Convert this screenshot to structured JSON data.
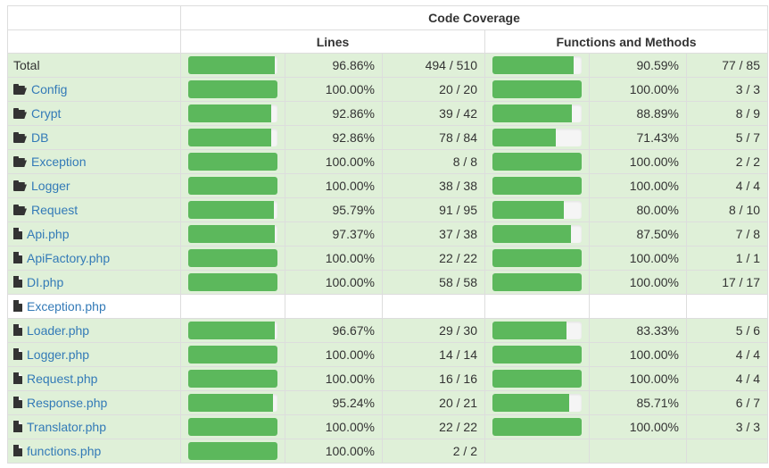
{
  "header": {
    "code_coverage": "Code Coverage",
    "lines": "Lines",
    "functions_methods": "Functions and Methods"
  },
  "colors": {
    "bar_fill": "#5cb85c",
    "row_success_bg": "#dff0d8",
    "link": "#337ab7"
  },
  "rows": [
    {
      "name": "Total",
      "type": "total",
      "lines_pct": "96.86%",
      "lines_ratio": "494 / 510",
      "lines_fill": 0.9686,
      "fn_pct": "90.59%",
      "fn_ratio": "77 / 85",
      "fn_fill": 0.9059,
      "icon": "none"
    },
    {
      "name": "Config",
      "type": "dir",
      "lines_pct": "100.00%",
      "lines_ratio": "20 / 20",
      "lines_fill": 1.0,
      "fn_pct": "100.00%",
      "fn_ratio": "3 / 3",
      "fn_fill": 1.0,
      "icon": "folder-icon"
    },
    {
      "name": "Crypt",
      "type": "dir",
      "lines_pct": "92.86%",
      "lines_ratio": "39 / 42",
      "lines_fill": 0.9286,
      "fn_pct": "88.89%",
      "fn_ratio": "8 / 9",
      "fn_fill": 0.8889,
      "icon": "folder-icon"
    },
    {
      "name": "DB",
      "type": "dir",
      "lines_pct": "92.86%",
      "lines_ratio": "78 / 84",
      "lines_fill": 0.9286,
      "fn_pct": "71.43%",
      "fn_ratio": "5 / 7",
      "fn_fill": 0.7143,
      "icon": "folder-icon"
    },
    {
      "name": "Exception",
      "type": "dir",
      "lines_pct": "100.00%",
      "lines_ratio": "8 / 8",
      "lines_fill": 1.0,
      "fn_pct": "100.00%",
      "fn_ratio": "2 / 2",
      "fn_fill": 1.0,
      "icon": "folder-icon"
    },
    {
      "name": "Logger",
      "type": "dir",
      "lines_pct": "100.00%",
      "lines_ratio": "38 / 38",
      "lines_fill": 1.0,
      "fn_pct": "100.00%",
      "fn_ratio": "4 / 4",
      "fn_fill": 1.0,
      "icon": "folder-icon"
    },
    {
      "name": "Request",
      "type": "dir",
      "lines_pct": "95.79%",
      "lines_ratio": "91 / 95",
      "lines_fill": 0.9579,
      "fn_pct": "80.00%",
      "fn_ratio": "8 / 10",
      "fn_fill": 0.8,
      "icon": "folder-icon"
    },
    {
      "name": "Api.php",
      "type": "file",
      "lines_pct": "97.37%",
      "lines_ratio": "37 / 38",
      "lines_fill": 0.9737,
      "fn_pct": "87.50%",
      "fn_ratio": "7 / 8",
      "fn_fill": 0.875,
      "icon": "file-icon"
    },
    {
      "name": "ApiFactory.php",
      "type": "file",
      "lines_pct": "100.00%",
      "lines_ratio": "22 / 22",
      "lines_fill": 1.0,
      "fn_pct": "100.00%",
      "fn_ratio": "1 / 1",
      "fn_fill": 1.0,
      "icon": "file-icon"
    },
    {
      "name": "DI.php",
      "type": "file",
      "lines_pct": "100.00%",
      "lines_ratio": "58 / 58",
      "lines_fill": 1.0,
      "fn_pct": "100.00%",
      "fn_ratio": "17 / 17",
      "fn_fill": 1.0,
      "icon": "file-icon"
    },
    {
      "name": "Exception.php",
      "type": "file-empty",
      "lines_pct": "",
      "lines_ratio": "",
      "lines_fill": null,
      "fn_pct": "",
      "fn_ratio": "",
      "fn_fill": null,
      "icon": "file-icon"
    },
    {
      "name": "Loader.php",
      "type": "file",
      "lines_pct": "96.67%",
      "lines_ratio": "29 / 30",
      "lines_fill": 0.9667,
      "fn_pct": "83.33%",
      "fn_ratio": "5 / 6",
      "fn_fill": 0.8333,
      "icon": "file-icon"
    },
    {
      "name": "Logger.php",
      "type": "file",
      "lines_pct": "100.00%",
      "lines_ratio": "14 / 14",
      "lines_fill": 1.0,
      "fn_pct": "100.00%",
      "fn_ratio": "4 / 4",
      "fn_fill": 1.0,
      "icon": "file-icon"
    },
    {
      "name": "Request.php",
      "type": "file",
      "lines_pct": "100.00%",
      "lines_ratio": "16 / 16",
      "lines_fill": 1.0,
      "fn_pct": "100.00%",
      "fn_ratio": "4 / 4",
      "fn_fill": 1.0,
      "icon": "file-icon"
    },
    {
      "name": "Response.php",
      "type": "file",
      "lines_pct": "95.24%",
      "lines_ratio": "20 / 21",
      "lines_fill": 0.9524,
      "fn_pct": "85.71%",
      "fn_ratio": "6 / 7",
      "fn_fill": 0.8571,
      "icon": "file-icon"
    },
    {
      "name": "Translator.php",
      "type": "file",
      "lines_pct": "100.00%",
      "lines_ratio": "22 / 22",
      "lines_fill": 1.0,
      "fn_pct": "100.00%",
      "fn_ratio": "3 / 3",
      "fn_fill": 1.0,
      "icon": "file-icon"
    },
    {
      "name": "functions.php",
      "type": "file",
      "lines_pct": "100.00%",
      "lines_ratio": "2 / 2",
      "lines_fill": 1.0,
      "fn_pct": "",
      "fn_ratio": "",
      "fn_fill": null,
      "icon": "file-icon"
    }
  ]
}
